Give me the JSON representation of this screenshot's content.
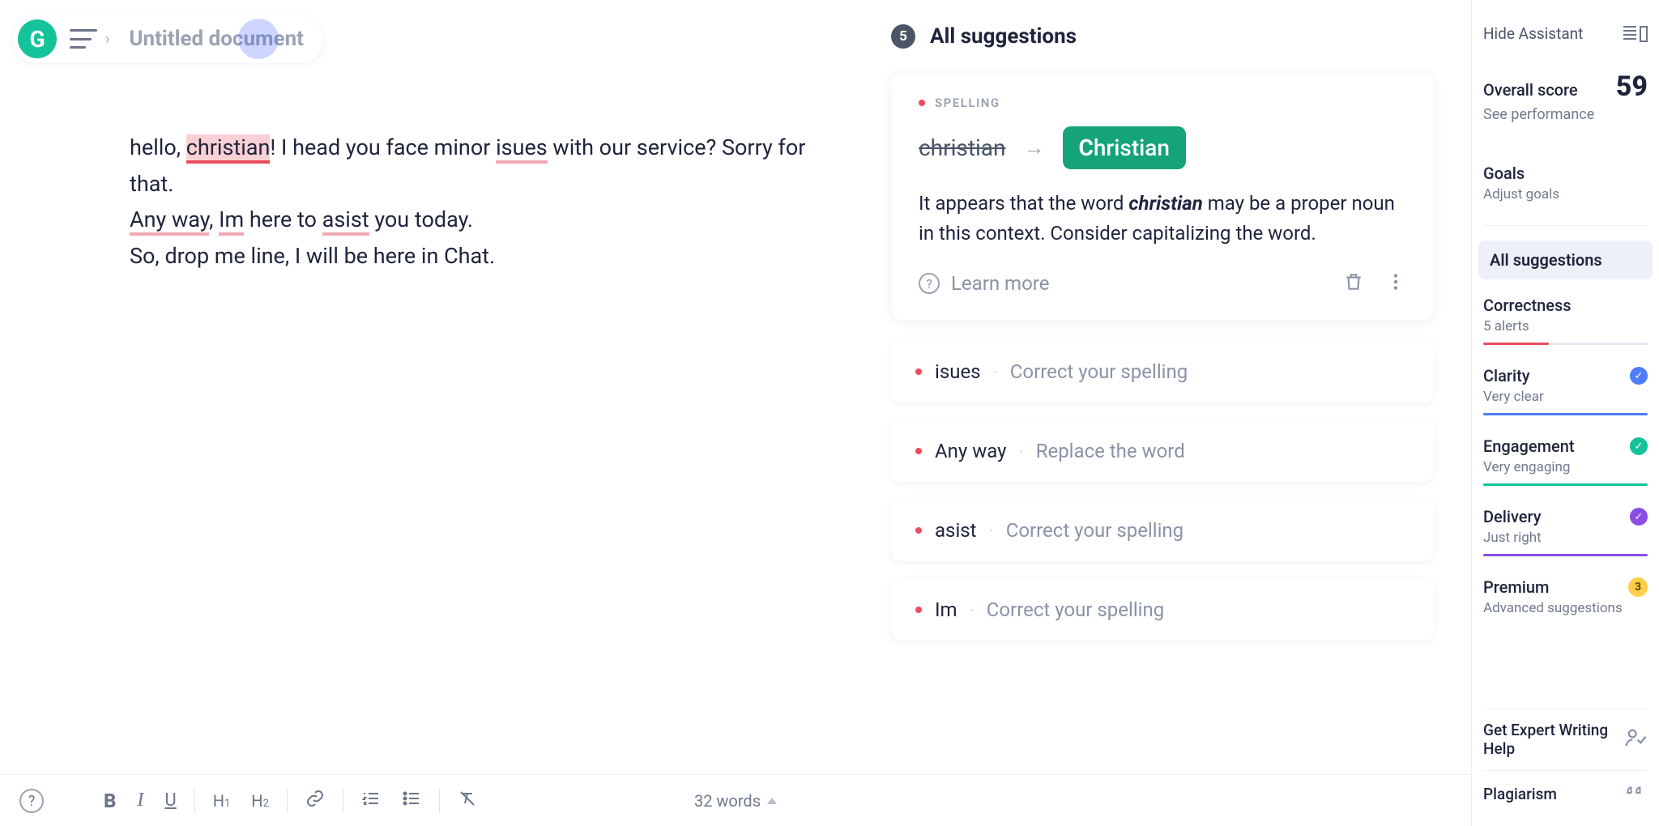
{
  "header": {
    "doc_title": "Untitled document",
    "hide_assistant": "Hide Assistant"
  },
  "editor": {
    "line1_a": "hello, ",
    "line1_christian": "christian",
    "line1_b": "! I head you face minor ",
    "line1_isues": "isues",
    "line1_c": " with our service? Sorry for that.",
    "line2_anyway": "Any way",
    "line2_a": ", ",
    "line2_im": "Im",
    "line2_b": " here to ",
    "line2_asist": "asist",
    "line2_c": " you today.",
    "line3": "So, drop me line, I will be here in Chat."
  },
  "suggestions": {
    "count": "5",
    "title": "All suggestions",
    "expanded": {
      "category": "SPELLING",
      "wrong": "christian",
      "fix_prefix": "C",
      "fix_rest": "hristian",
      "explain_a": "It appears that the word ",
      "explain_word": "christian",
      "explain_b": " may be a proper noun in this context. Consider capitalizing the word.",
      "learn_more": "Learn more"
    },
    "items": [
      {
        "word": "isues",
        "hint": "Correct your spelling"
      },
      {
        "word": "Any way",
        "hint": "Replace the word"
      },
      {
        "word": "asist",
        "hint": "Correct your spelling"
      },
      {
        "word": "Im",
        "hint": "Correct your spelling"
      }
    ]
  },
  "sidebar": {
    "overall_label": "Overall score",
    "overall_value": "59",
    "see_perf": "See performance",
    "goals_t": "Goals",
    "goals_s": "Adjust goals",
    "all_sugg": "All suggestions",
    "correctness_t": "Correctness",
    "correctness_s": "5 alerts",
    "clarity_t": "Clarity",
    "clarity_s": "Very clear",
    "engagement_t": "Engagement",
    "engagement_s": "Very engaging",
    "delivery_t": "Delivery",
    "delivery_s": "Just right",
    "premium_t": "Premium",
    "premium_s": "Advanced suggestions",
    "premium_badge": "3",
    "expert_t": "Get Expert Writing Help",
    "plagiarism_t": "Plagiarism"
  },
  "bottom": {
    "wordcount": "32 words"
  }
}
